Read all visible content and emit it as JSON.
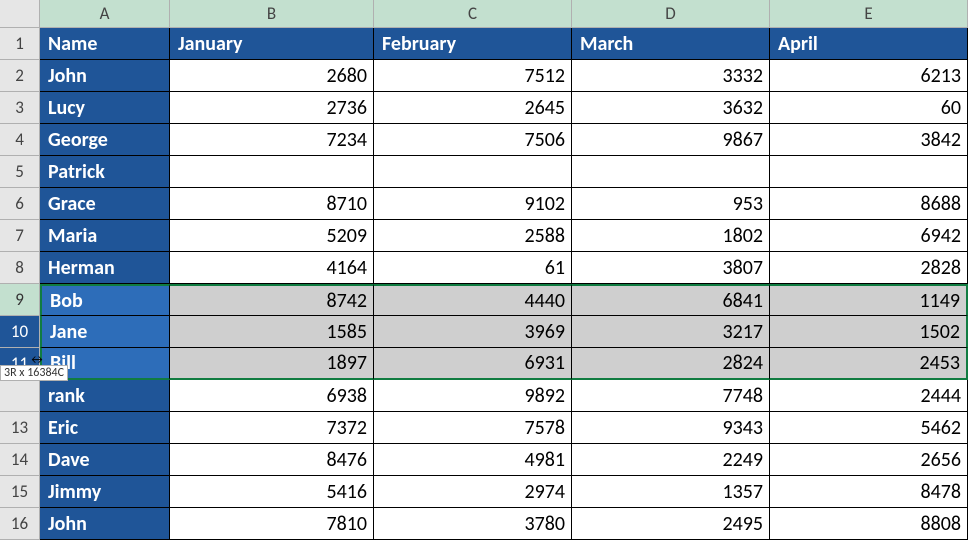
{
  "columns": [
    "A",
    "B",
    "C",
    "D",
    "E"
  ],
  "selection_tip": "3R x 16384C",
  "chart_data": {
    "type": "table",
    "title": "",
    "columns": [
      "Name",
      "January",
      "February",
      "March",
      "April"
    ],
    "rows": [
      {
        "Name": "John",
        "January": 2680,
        "February": 7512,
        "March": 3332,
        "April": 6213
      },
      {
        "Name": "Lucy",
        "January": 2736,
        "February": 2645,
        "March": 3632,
        "April": 60
      },
      {
        "Name": "George",
        "January": 7234,
        "February": 7506,
        "March": 9867,
        "April": 3842
      },
      {
        "Name": "Patrick",
        "January": null,
        "February": null,
        "March": null,
        "April": null
      },
      {
        "Name": "Grace",
        "January": 8710,
        "February": 9102,
        "March": 953,
        "April": 8688
      },
      {
        "Name": "Maria",
        "January": 5209,
        "February": 2588,
        "March": 1802,
        "April": 6942
      },
      {
        "Name": "Herman",
        "January": 4164,
        "February": 61,
        "March": 3807,
        "April": 2828
      },
      {
        "Name": "Bob",
        "January": 8742,
        "February": 4440,
        "March": 6841,
        "April": 1149
      },
      {
        "Name": "Jane",
        "January": 1585,
        "February": 3969,
        "March": 3217,
        "April": 1502
      },
      {
        "Name": "Bill",
        "January": 1897,
        "February": 6931,
        "March": 2824,
        "April": 2453
      },
      {
        "Name": "rank",
        "January": 6938,
        "February": 9892,
        "March": 7748,
        "April": 2444
      },
      {
        "Name": "Eric",
        "January": 7372,
        "February": 7578,
        "March": 9343,
        "April": 5462
      },
      {
        "Name": "Dave",
        "January": 8476,
        "February": 4981,
        "March": 2249,
        "April": 2656
      },
      {
        "Name": "Jimmy",
        "January": 5416,
        "February": 2974,
        "March": 1357,
        "April": 8478
      },
      {
        "Name": "John",
        "January": 7810,
        "February": 3780,
        "March": 2495,
        "April": 8808
      }
    ]
  },
  "headers": {
    "A": "Name",
    "B": "January",
    "C": "February",
    "D": "March",
    "E": "April"
  },
  "row_numbers": [
    "1",
    "2",
    "3",
    "4",
    "5",
    "6",
    "7",
    "8",
    "9",
    "10",
    "11",
    "",
    "13",
    "14",
    "15",
    "16"
  ],
  "selected_rows": [
    9,
    10,
    11
  ]
}
